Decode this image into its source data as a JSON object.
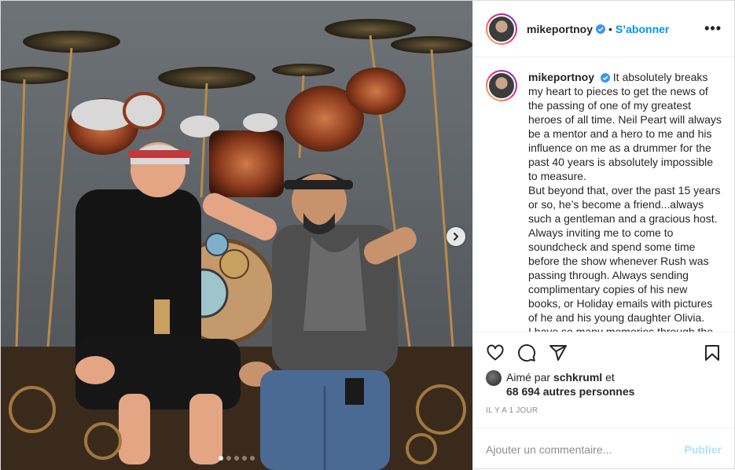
{
  "post": {
    "author": "mikeportnoy",
    "follow_separator": "•",
    "follow_label": "S’abonner",
    "more_label": "•••",
    "caption_username": "mikeportnoy",
    "caption_text": "It absolutely breaks my heart to pieces to get the news of the passing of one of my greatest heroes of all time. Neil Peart will always be a mentor and a hero to me and his influence on me as a drummer for the past 40 years is absolutely impossible to measure.\nBut beyond that, over the past 15 years or so, he’s become a friend...always such a gentleman and a gracious host. Always inviting me to come to soundcheck and spend some time before the show whenever Rush was passing through. Always sending complimentary copies of his new books, or Holiday emails with pictures of he and his young daughter Olivia.\nI have so many memories through the",
    "liked_prefix": "Aimé par",
    "liked_user": "schkruml",
    "liked_conj": "et",
    "liked_others": "68 694 autres personnes",
    "time_ago": "IL Y A 1 JOUR",
    "comment_placeholder": "Ajouter un commentaire...",
    "publish_label": "Publier"
  },
  "icons": {
    "like": "heart-icon",
    "comment": "comment-icon",
    "share": "share-icon",
    "save": "bookmark-icon",
    "next": "chevron-right-icon"
  },
  "colors": {
    "follow": "#0095f6",
    "publish_disabled": "#b2dffc",
    "muted": "#8e8e8e",
    "text": "#262626"
  },
  "carousel": {
    "slides": 5,
    "active_slide": 1
  }
}
